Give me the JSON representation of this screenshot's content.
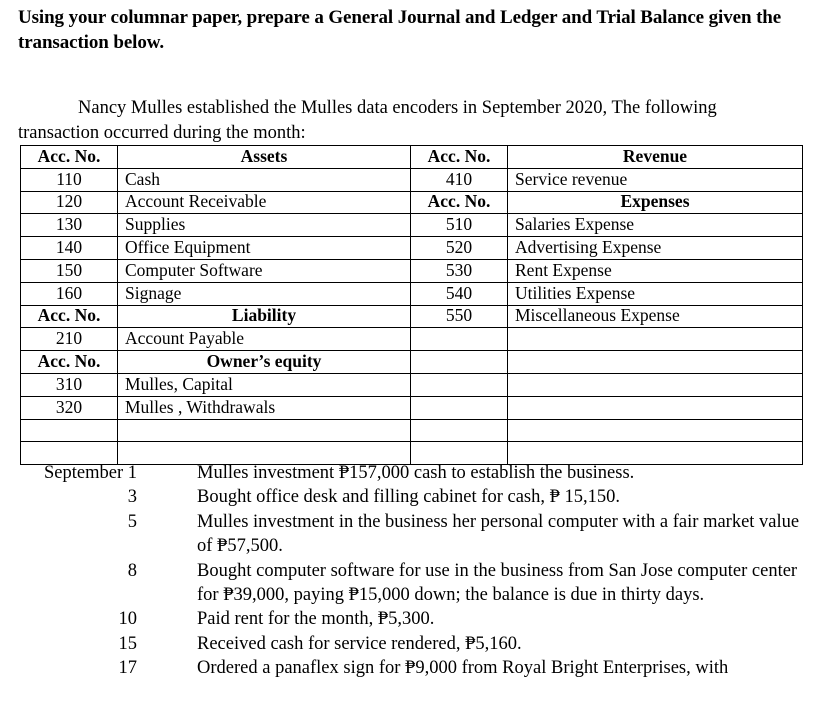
{
  "document": {
    "heading": "Using your columnar paper, prepare a General Journal and Ledger  and Trial Balance given the transaction below.",
    "intro_paragraph": "Nancy Mulles established the Mulles data encoders in September 2020, The following transaction occurred during the month:"
  },
  "accounts_table": {
    "rows": [
      {
        "c1": "Acc. No.",
        "c2": "Assets",
        "c3": "Acc. No.",
        "c4": "Revenue",
        "h1": true,
        "h2": true,
        "h3": true,
        "h4": true
      },
      {
        "c1": "110",
        "c2": "Cash",
        "c3": "410",
        "c4": "Service revenue",
        "h1": false,
        "h2": false,
        "h3": false,
        "h4": false
      },
      {
        "c1": "120",
        "c2": "Account Receivable",
        "c3": "Acc. No.",
        "c4": "Expenses",
        "h1": false,
        "h2": false,
        "h3": true,
        "h4": true
      },
      {
        "c1": "130",
        "c2": "Supplies",
        "c3": "510",
        "c4": "Salaries Expense",
        "h1": false,
        "h2": false,
        "h3": false,
        "h4": false
      },
      {
        "c1": "140",
        "c2": "Office Equipment",
        "c3": "520",
        "c4": "Advertising Expense",
        "h1": false,
        "h2": false,
        "h3": false,
        "h4": false
      },
      {
        "c1": "150",
        "c2": "Computer Software",
        "c3": "530",
        "c4": "Rent Expense",
        "h1": false,
        "h2": false,
        "h3": false,
        "h4": false
      },
      {
        "c1": "160",
        "c2": "Signage",
        "c3": "540",
        "c4": "Utilities Expense",
        "h1": false,
        "h2": false,
        "h3": false,
        "h4": false
      },
      {
        "c1": "Acc. No.",
        "c2": "Liability",
        "c3": "550",
        "c4": "Miscellaneous Expense",
        "h1": true,
        "h2": true,
        "h3": false,
        "h4": false
      },
      {
        "c1": "210",
        "c2": "Account Payable",
        "c3": "",
        "c4": "",
        "h1": false,
        "h2": false,
        "h3": false,
        "h4": false
      },
      {
        "c1": "Acc. No.",
        "c2": "Owner’s equity",
        "c3": "",
        "c4": "",
        "h1": true,
        "h2": true,
        "h3": false,
        "h4": false
      },
      {
        "c1": "310",
        "c2": "Mulles, Capital",
        "c3": "",
        "c4": "",
        "h1": false,
        "h2": false,
        "h3": false,
        "h4": false
      },
      {
        "c1": "320",
        "c2": "Mulles , Withdrawals",
        "c3": "",
        "c4": "",
        "h1": false,
        "h2": false,
        "h3": false,
        "h4": false
      },
      {
        "c1": "",
        "c2": "",
        "c3": "",
        "c4": "",
        "h1": false,
        "h2": false,
        "h3": false,
        "h4": false
      },
      {
        "c1": "",
        "c2": "",
        "c3": "",
        "c4": "",
        "h1": false,
        "h2": false,
        "h3": false,
        "h4": false
      }
    ]
  },
  "transactions": {
    "entries": [
      {
        "date": "September 1",
        "description": "Mulles investment ₱157,000 cash to establish the business."
      },
      {
        "date": "3",
        "description": "Bought office desk and filling cabinet for cash, ₱ 15,150."
      },
      {
        "date": "5",
        "description": "Mulles investment in the business her personal computer with a fair market value of ₱57,500."
      },
      {
        "date": "8",
        "description": "Bought computer software for use in the business from San Jose computer center for ₱39,000, paying ₱15,000 down; the balance is due in thirty days."
      },
      {
        "date": "10",
        "description": "Paid rent for the month, ₱5,300."
      },
      {
        "date": "15",
        "description": "Received cash for service rendered, ₱5,160."
      },
      {
        "date": "17",
        "description": "Ordered a panaflex sign for ₱9,000 from Royal Bright Enterprises, with"
      }
    ]
  },
  "colors": {
    "background": "#ffffff",
    "text": "#000000",
    "table_border": "#000000"
  }
}
